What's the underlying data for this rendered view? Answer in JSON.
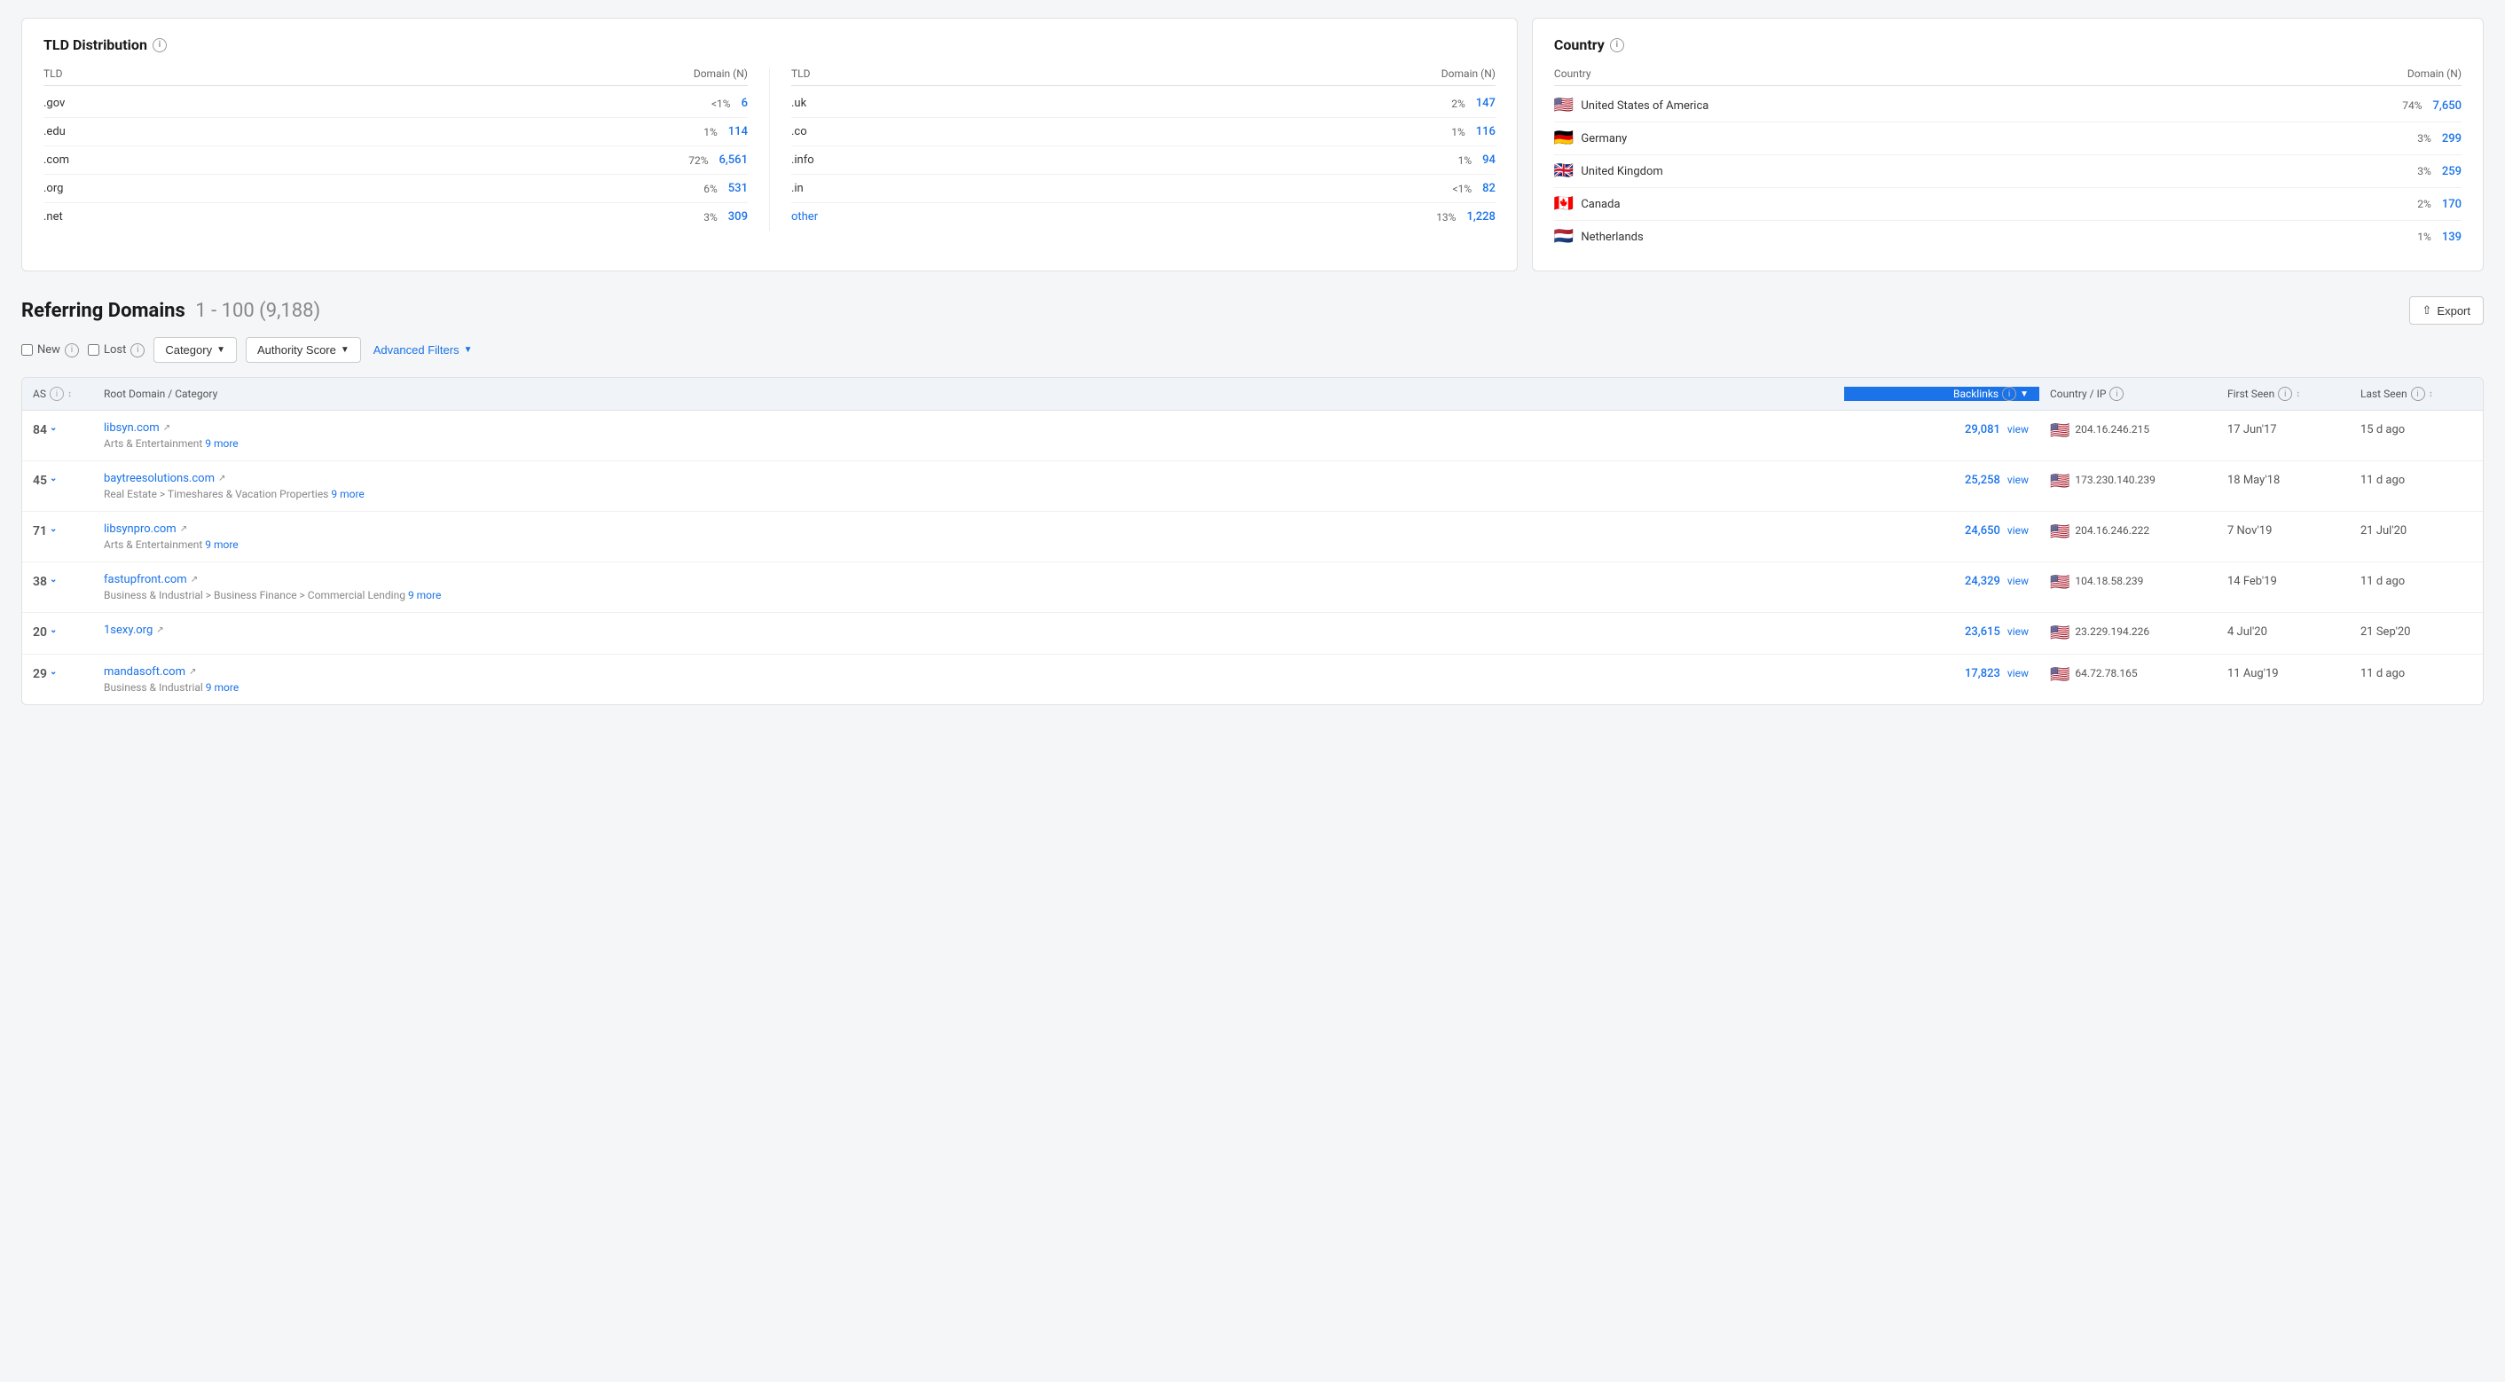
{
  "tld": {
    "title": "TLD Distribution",
    "col1_header": "TLD",
    "col2_header": "Domain (N)",
    "left_rows": [
      {
        "tld": ".gov",
        "pct": "<1%",
        "num": "6"
      },
      {
        "tld": ".edu",
        "pct": "1%",
        "num": "114"
      },
      {
        "tld": ".com",
        "pct": "72%",
        "num": "6,561"
      },
      {
        "tld": ".org",
        "pct": "6%",
        "num": "531"
      },
      {
        "tld": ".net",
        "pct": "3%",
        "num": "309"
      }
    ],
    "right_rows": [
      {
        "tld": ".uk",
        "pct": "2%",
        "num": "147"
      },
      {
        "tld": ".co",
        "pct": "1%",
        "num": "116"
      },
      {
        "tld": ".info",
        "pct": "1%",
        "num": "94"
      },
      {
        "tld": ".in",
        "pct": "<1%",
        "num": "82"
      },
      {
        "tld": "other",
        "pct": "13%",
        "num": "1,228"
      }
    ]
  },
  "country": {
    "title": "Country",
    "col_country": "Country",
    "col_domain_n": "Domain (N)",
    "rows": [
      {
        "flag": "🇺🇸",
        "name": "United States of America",
        "pct": "74%",
        "num": "7,650"
      },
      {
        "flag": "🇩🇪",
        "name": "Germany",
        "pct": "3%",
        "num": "299"
      },
      {
        "flag": "🇬🇧",
        "name": "United Kingdom",
        "pct": "3%",
        "num": "259"
      },
      {
        "flag": "🇨🇦",
        "name": "Canada",
        "pct": "2%",
        "num": "170"
      },
      {
        "flag": "🇳🇱",
        "name": "Netherlands",
        "pct": "1%",
        "num": "139"
      }
    ]
  },
  "referring_domains": {
    "title": "Referring Domains",
    "range": "1 - 100 (9,188)",
    "export_label": "Export",
    "filters": {
      "new_label": "New",
      "lost_label": "Lost",
      "category_label": "Category",
      "authority_score_label": "Authority Score",
      "advanced_filters_label": "Advanced Filters"
    },
    "table": {
      "col_as": "AS",
      "col_domain": "Root Domain / Category",
      "col_backlinks": "Backlinks",
      "col_country_ip": "Country / IP",
      "col_first_seen": "First Seen",
      "col_last_seen": "Last Seen",
      "rows": [
        {
          "as_num": "84",
          "domain": "libsyn.com",
          "category": "Arts & Entertainment",
          "more": "9 more",
          "backlinks": "29,081",
          "flag": "🇺🇸",
          "ip": "204.16.246.215",
          "first_seen": "17 Jun'17",
          "last_seen": "15 d ago"
        },
        {
          "as_num": "45",
          "domain": "baytreesolutions.com",
          "category": "Real Estate > Timeshares & Vacation Properties",
          "more": "9 more",
          "backlinks": "25,258",
          "flag": "🇺🇸",
          "ip": "173.230.140.239",
          "first_seen": "18 May'18",
          "last_seen": "11 d ago"
        },
        {
          "as_num": "71",
          "domain": "libsynpro.com",
          "category": "Arts & Entertainment",
          "more": "9 more",
          "backlinks": "24,650",
          "flag": "🇺🇸",
          "ip": "204.16.246.222",
          "first_seen": "7 Nov'19",
          "last_seen": "21 Jul'20"
        },
        {
          "as_num": "38",
          "domain": "fastupfront.com",
          "category": "Business & Industrial > Business Finance > Commercial Lending",
          "more": "9 more",
          "backlinks": "24,329",
          "flag": "🇺🇸",
          "ip": "104.18.58.239",
          "first_seen": "14 Feb'19",
          "last_seen": "11 d ago"
        },
        {
          "as_num": "20",
          "domain": "1sexy.org",
          "category": "",
          "more": "",
          "backlinks": "23,615",
          "flag": "🇺🇸",
          "ip": "23.229.194.226",
          "first_seen": "4 Jul'20",
          "last_seen": "21 Sep'20"
        },
        {
          "as_num": "29",
          "domain": "mandasoft.com",
          "category": "Business & Industrial",
          "more": "9 more",
          "backlinks": "17,823",
          "flag": "🇺🇸",
          "ip": "64.72.78.165",
          "first_seen": "11 Aug'19",
          "last_seen": "11 d ago"
        }
      ]
    }
  }
}
